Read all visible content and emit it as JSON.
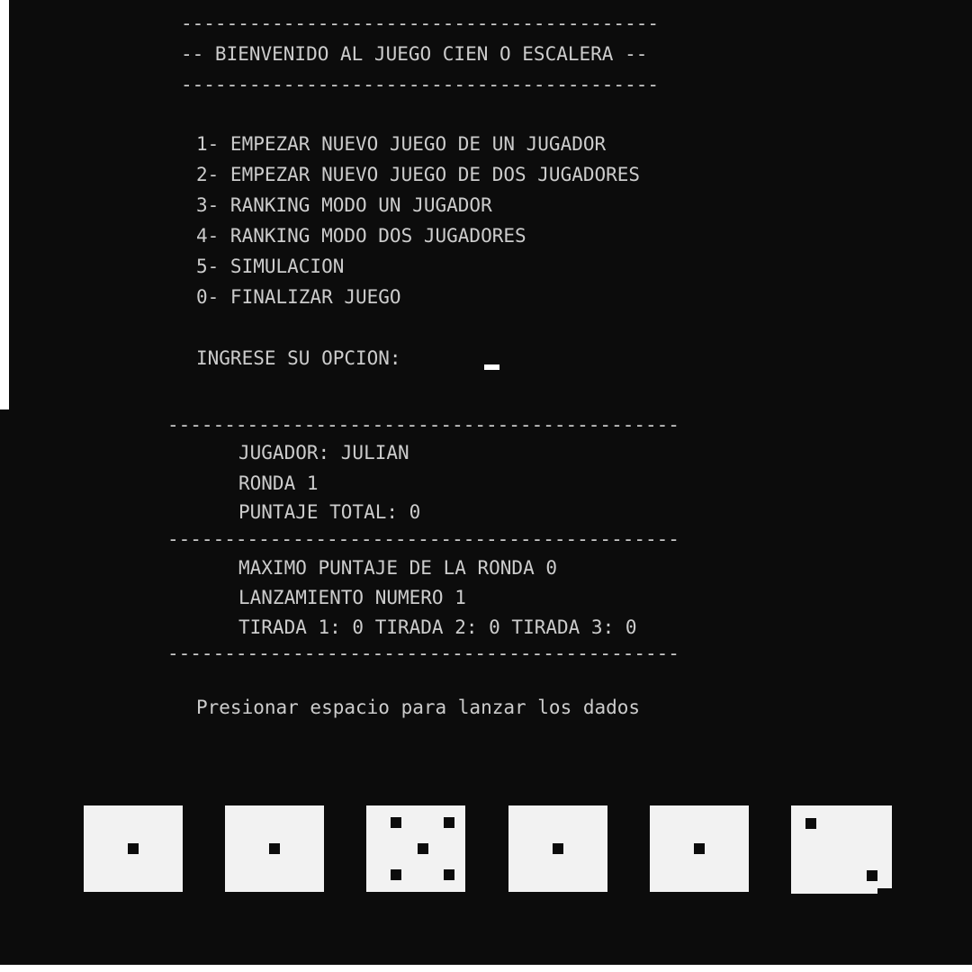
{
  "menu": {
    "separator": "------------------------------------------",
    "title": "-- BIENVENIDO AL JUEGO CIEN O ESCALERA --",
    "options": [
      "1- EMPEZAR NUEVO JUEGO DE UN JUGADOR",
      "2- EMPEZAR NUEVO JUEGO DE DOS JUGADORES",
      "3- RANKING MODO UN JUGADOR",
      "4- RANKING MODO DOS JUGADORES",
      "5- SIMULACION",
      "0- FINALIZAR JUEGO"
    ],
    "prompt": "INGRESE SU OPCION:"
  },
  "game": {
    "separator": "---------------------------------------------",
    "player": "JUGADOR: JULIAN",
    "round": "RONDA 1",
    "total_score": "PUNTAJE TOTAL: 0",
    "round_max": "MAXIMO PUNTAJE DE LA RONDA 0",
    "throw_number": "LANZAMIENTO NUMERO 1",
    "rolls": "TIRADA 1: 0 TIRADA 2: 0 TIRADA 3: 0",
    "instruction": "Presionar espacio para lanzar los dados"
  },
  "dice": [
    {
      "face": 1
    },
    {
      "face": 1
    },
    {
      "face": 5
    },
    {
      "face": 1
    },
    {
      "face": 1
    },
    {
      "face": 2
    }
  ],
  "colors": {
    "console_bg": "#0c0c0c",
    "console_text": "#cccccc",
    "die_face": "#f2f2f2",
    "pip": "#0c0c0c"
  }
}
